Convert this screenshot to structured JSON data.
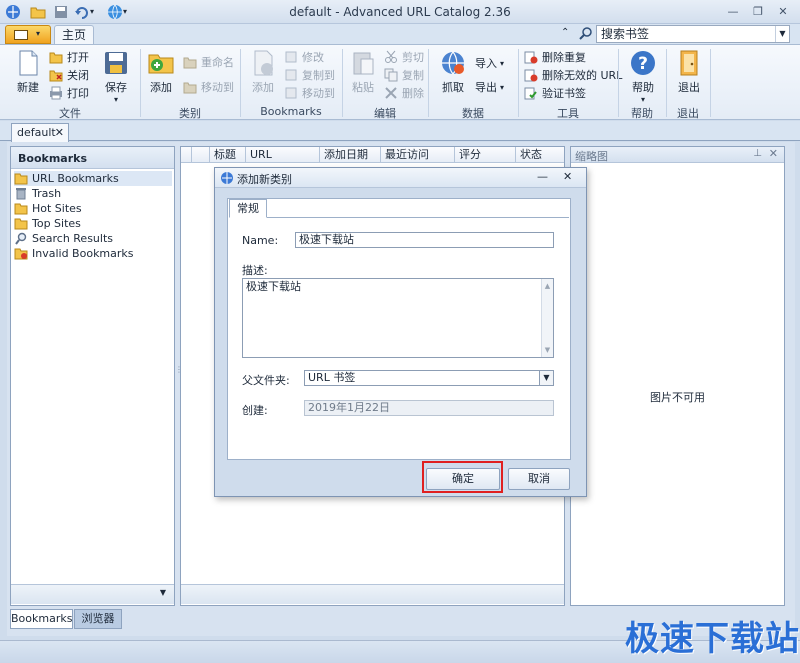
{
  "window": {
    "title": "default - Advanced URL Catalog 2.36",
    "minimize": "—",
    "restore": "❐",
    "close": "✕"
  },
  "ribbon_tabs": {
    "active": "主页"
  },
  "search": {
    "placeholder": "搜索书签"
  },
  "ribbon": {
    "file": {
      "label": "文件",
      "new": "新建",
      "open": "打开",
      "close": "关闭",
      "print": "打印",
      "save": "保存"
    },
    "category": {
      "label": "类别",
      "add": "添加",
      "rename": "重命名",
      "move": "移动到"
    },
    "bookmarks": {
      "label": "Bookmarks",
      "add": "添加",
      "edit": "修改",
      "copy_to": "复制到",
      "move_to": "移动到"
    },
    "edit": {
      "label": "编辑",
      "paste": "粘贴",
      "cut": "剪切",
      "copy": "复制",
      "delete": "删除"
    },
    "data": {
      "label": "数据",
      "grab": "抓取",
      "import": "导入",
      "export": "导出"
    },
    "tools": {
      "label": "工具",
      "remove_dup": "删除重复",
      "remove_invalid": "删除无效的 URL",
      "verify": "验证书签"
    },
    "help": {
      "label": "帮助",
      "help": "帮助"
    },
    "exit": {
      "label": "退出",
      "exit": "退出"
    }
  },
  "doc_tab": {
    "label": "default",
    "close": "✕"
  },
  "left_panel": {
    "title": "Bookmarks",
    "items": [
      {
        "label": "URL Bookmarks",
        "icon": "folder-star-icon"
      },
      {
        "label": "Trash",
        "icon": "trash-icon"
      },
      {
        "label": "Hot Sites",
        "icon": "folder-star-icon"
      },
      {
        "label": "Top Sites",
        "icon": "folder-star-icon"
      },
      {
        "label": "Search Results",
        "icon": "search-icon"
      },
      {
        "label": "Invalid Bookmarks",
        "icon": "warning-icon"
      }
    ]
  },
  "grid": {
    "columns": [
      "标题",
      "URL",
      "添加日期",
      "最近访问",
      "评分",
      "状态"
    ]
  },
  "thumbnail": {
    "title": "缩略图",
    "unavailable": "图片不可用"
  },
  "bottom_tabs": [
    "Bookmarks",
    "浏览器"
  ],
  "dialog": {
    "title": "添加新类别",
    "tab": "常规",
    "name_label": "Name:",
    "name_value": "极速下载站",
    "desc_label": "描述:",
    "desc_value": "极速下载站",
    "parent_label": "父文件夹:",
    "parent_value": "URL 书签",
    "created_label": "创建:",
    "created_value": "2019年1月22日",
    "ok": "确定",
    "cancel": "取消"
  },
  "watermark": "极速下载站",
  "colors": {
    "accent": "#2a6fd6",
    "highlight": "#e02020",
    "ribbon_menu": "#f0a21f"
  }
}
